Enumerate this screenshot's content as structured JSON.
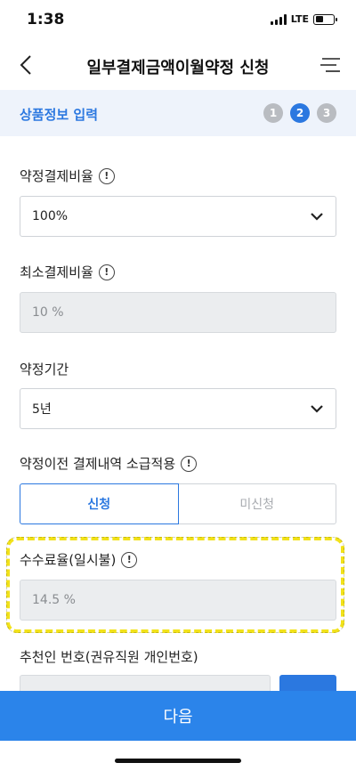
{
  "status": {
    "time": "1:38",
    "network": "LTE"
  },
  "header": {
    "title": "일부결제금액이월약정 신청"
  },
  "step": {
    "title": "상품정보 입력",
    "steps": [
      "1",
      "2",
      "3"
    ]
  },
  "form": {
    "rate": {
      "label": "약정결제비율",
      "value": "100%"
    },
    "min_rate": {
      "label": "최소결제비율",
      "value": "10 %"
    },
    "period": {
      "label": "약정기간",
      "value": "5년"
    },
    "retro": {
      "label": "약정이전 결제내역 소급적용",
      "on_label": "신청",
      "off_label": "미신청",
      "selected": "신청"
    },
    "fee": {
      "label": "수수료율(일시불)",
      "value": "14.5 %"
    },
    "referrer": {
      "label": "추천인 번호(권유직원 개인번호)"
    }
  },
  "footer": {
    "next_label": "다음"
  },
  "colors": {
    "accent": "#2b78e0",
    "highlight": "#f2e21a"
  }
}
